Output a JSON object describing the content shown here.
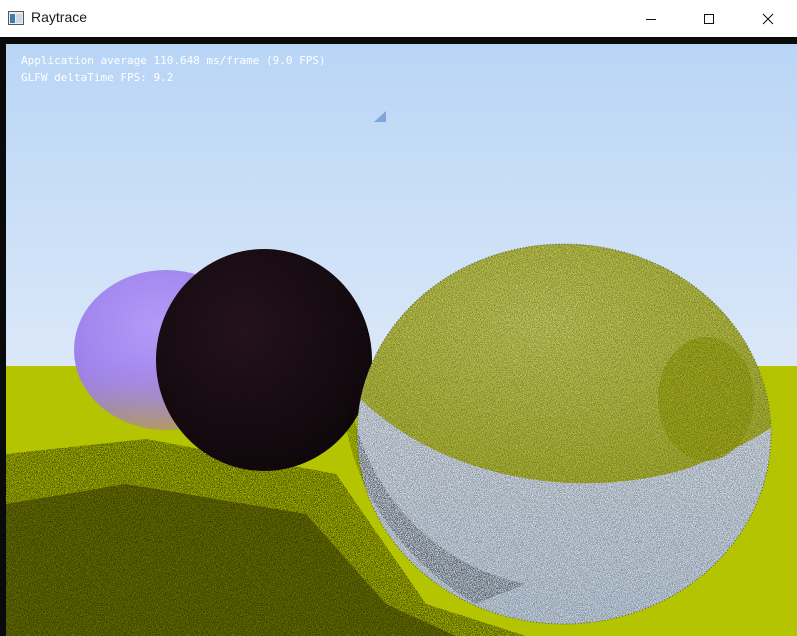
{
  "window": {
    "title": "Raytrace",
    "buttons": {
      "minimize": "minimize",
      "maximize": "maximize",
      "close": "close"
    }
  },
  "overlay": {
    "line1": "Application average 110.648 ms/frame (9.0 FPS)",
    "line2": "GLFW deltaTime FPS: 9.2"
  },
  "scene": {
    "sky_top": "#b9d5f6",
    "sky_bottom": "#eef4fc",
    "ground": "#b4c400",
    "sphere_left": "#a58af2",
    "sphere_middle": "#1b0d14",
    "sphere_right_glass": "#c8d44a"
  }
}
